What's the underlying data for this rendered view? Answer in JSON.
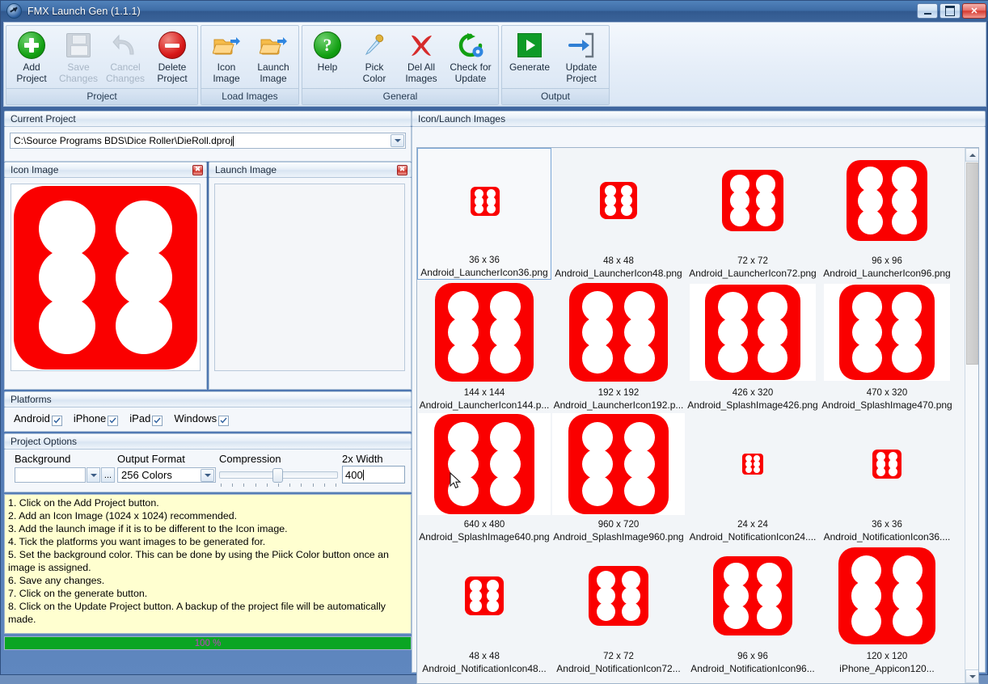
{
  "window": {
    "title": "FMX Launch Gen (1.1.1)",
    "app_icon": "rocket-icon",
    "buttons": {
      "minimize": "minimize-icon",
      "maximize": "maximize-icon",
      "close": "close-icon"
    }
  },
  "ribbon": {
    "groups": [
      {
        "label": "Project",
        "buttons": [
          {
            "icon": "add-circle-icon",
            "line1": "Add",
            "line2": "Project",
            "disabled": false
          },
          {
            "icon": "save-floppy-icon",
            "line1": "Save",
            "line2": "Changes",
            "disabled": true
          },
          {
            "icon": "undo-arrow-icon",
            "line1": "Cancel",
            "line2": "Changes",
            "disabled": true
          },
          {
            "icon": "delete-circle-icon",
            "line1": "Delete",
            "line2": "Project",
            "disabled": false
          }
        ]
      },
      {
        "label": "Load Images",
        "buttons": [
          {
            "icon": "folder-open-icon",
            "line1": "Icon",
            "line2": "Image",
            "disabled": false
          },
          {
            "icon": "folder-open-icon",
            "line1": "Launch",
            "line2": "Image",
            "disabled": false
          }
        ]
      },
      {
        "label": "General",
        "buttons": [
          {
            "icon": "help-question-icon",
            "line1": "Help",
            "line2": "",
            "disabled": false
          },
          {
            "icon": "eyedropper-icon",
            "line1": "Pick",
            "line2": "Color",
            "disabled": false
          },
          {
            "icon": "red-x-icon",
            "line1": "Del All",
            "line2": "Images",
            "disabled": false
          },
          {
            "icon": "refresh-gear-icon",
            "line1": "Check for",
            "line2": "Update",
            "disabled": false
          }
        ]
      },
      {
        "label": "Output",
        "buttons": [
          {
            "icon": "play-green-icon",
            "line1": "Generate",
            "line2": "",
            "disabled": false
          },
          {
            "icon": "import-arrow-icon",
            "line1": "Update",
            "line2": "Project",
            "disabled": false
          }
        ]
      }
    ]
  },
  "current_project": {
    "panel_title": "Current Project",
    "path": "C:\\Source Programs BDS\\Dice Roller\\DieRoll.dproj"
  },
  "icon_image": {
    "panel_title": "Icon Image",
    "close_glyph": "✖",
    "has_image": true
  },
  "launch_image": {
    "panel_title": "Launch Image",
    "close_glyph": "✖",
    "has_image": false
  },
  "platforms": {
    "panel_title": "Platforms",
    "items": [
      {
        "label": "Android",
        "checked": true
      },
      {
        "label": "iPhone",
        "checked": true
      },
      {
        "label": "iPad",
        "checked": true
      },
      {
        "label": "Windows",
        "checked": true
      }
    ]
  },
  "project_options": {
    "panel_title": "Project Options",
    "background": {
      "label": "Background",
      "value": "",
      "ellipsis_label": "..."
    },
    "output_format": {
      "label": "Output Format",
      "value": "256 Colors"
    },
    "compression": {
      "label": "Compression",
      "value": 45
    },
    "two_x_width": {
      "label": "2x Width",
      "value": "400"
    }
  },
  "instructions": {
    "lines": [
      "1. Click on the Add Project button.",
      "2. Add an Icon Image (1024 x 1024) recommended.",
      "3. Add the launch image if it is to be different to the Icon image.",
      "4. Tick the platforms you want images to be generated for.",
      "5. Set the background color. This can be done by using the Piick Color button once an image is assigned.",
      "6. Save any changes.",
      "7. Click on the generate button.",
      "8. Click on the Update Project button. A backup of the project file will be automatically made."
    ]
  },
  "progress": {
    "value": 100,
    "text": "100 %",
    "color": "#0aa523",
    "text_color": "#c040c0"
  },
  "gallery": {
    "panel_title": "Icon/Launch Images",
    "selected_index": 0,
    "items": [
      {
        "dim": "36 x 36",
        "name": "Android_LauncherIcon36.png",
        "size": 36,
        "white_bg": false
      },
      {
        "dim": "48 x 48",
        "name": "Android_LauncherIcon48.png",
        "size": 46,
        "white_bg": false
      },
      {
        "dim": "72 x 72",
        "name": "Android_LauncherIcon72.png",
        "size": 76,
        "white_bg": false
      },
      {
        "dim": "96 x 96",
        "name": "Android_LauncherIcon96.png",
        "size": 100,
        "white_bg": false
      },
      {
        "dim": "144 x 144",
        "name": "Android_LauncherIcon144.p...",
        "size": 122,
        "white_bg": false
      },
      {
        "dim": "192 x 192",
        "name": "Android_LauncherIcon192.p...",
        "size": 122,
        "white_bg": false
      },
      {
        "dim": "426 x 320",
        "name": "Android_SplashImage426.png",
        "size": 118,
        "white_bg": true
      },
      {
        "dim": "470 x 320",
        "name": "Android_SplashImage470.png",
        "size": 118,
        "white_bg": true
      },
      {
        "dim": "640 x 480",
        "name": "Android_SplashImage640.png",
        "size": 124,
        "white_bg": true
      },
      {
        "dim": "960 x 720",
        "name": "Android_SplashImage960.png",
        "size": 124,
        "white_bg": true
      },
      {
        "dim": "24 x 24",
        "name": "Android_NotificationIcon24....",
        "size": 26,
        "white_bg": false
      },
      {
        "dim": "36 x 36",
        "name": "Android_NotificationIcon36....",
        "size": 36,
        "white_bg": false
      },
      {
        "dim": "48 x 48",
        "name": "Android_NotificationIcon48...",
        "size": 48,
        "white_bg": false
      },
      {
        "dim": "72 x 72",
        "name": "Android_NotificationIcon72...",
        "size": 74,
        "white_bg": false
      },
      {
        "dim": "96 x 96",
        "name": "Android_NotificationIcon96...",
        "size": 98,
        "white_bg": false
      },
      {
        "dim": "120 x 120",
        "name": "iPhone_Appicon120...",
        "size": 120,
        "white_bg": false
      }
    ]
  },
  "colors": {
    "die_red": "#fa0000",
    "pip_white": "#ffffff",
    "accent_blue": "#3e6ca6",
    "instructions_bg": "#ffffd0"
  }
}
